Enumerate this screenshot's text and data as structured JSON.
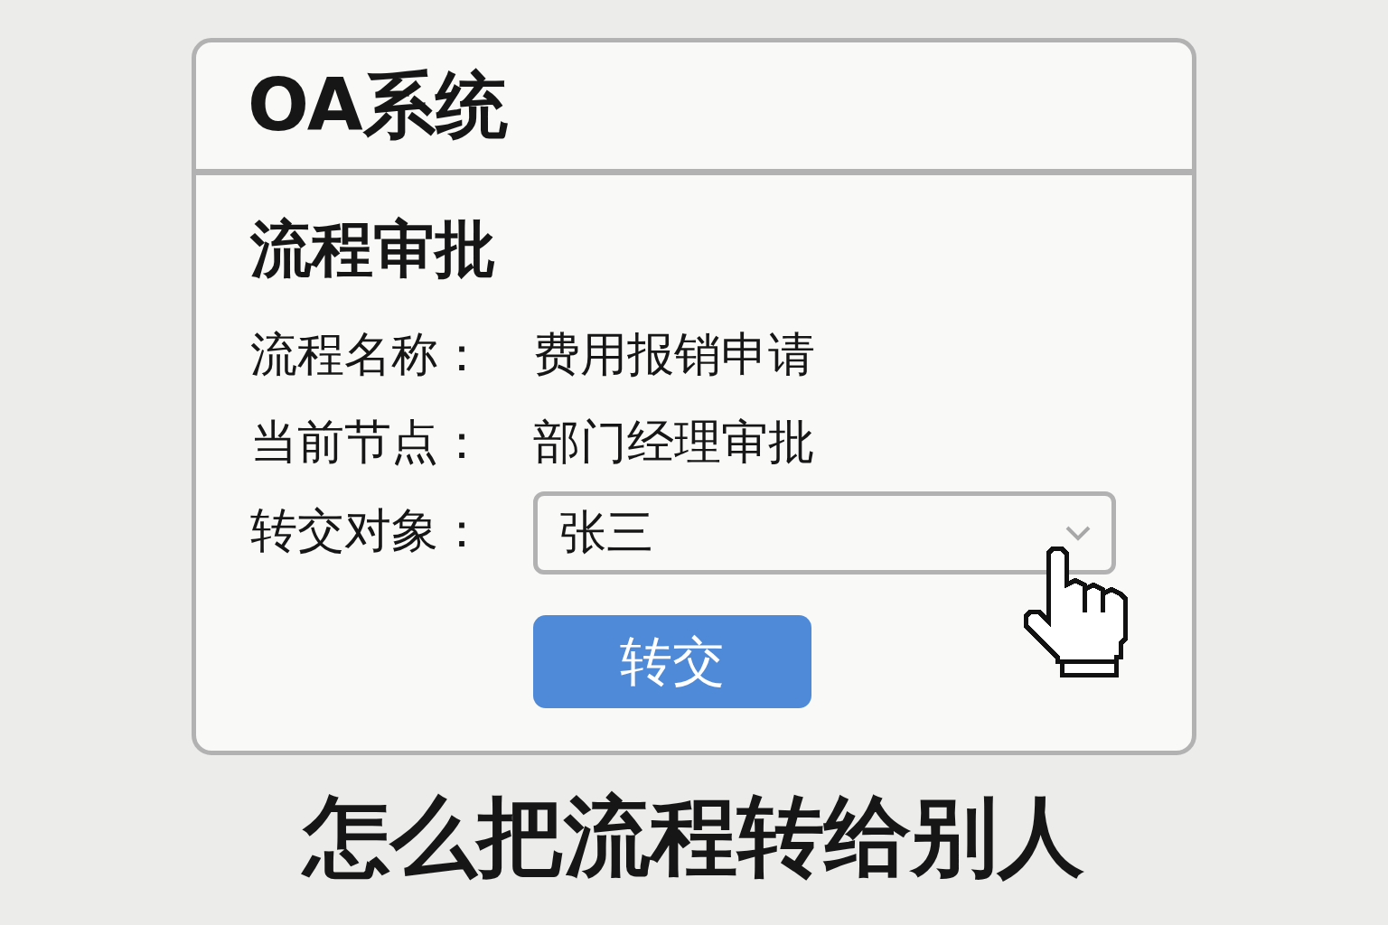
{
  "window": {
    "title": "OA系统"
  },
  "section": {
    "heading": "流程审批"
  },
  "fields": [
    {
      "kind": "text",
      "label": "流程名称：",
      "value": "费用报销申请"
    },
    {
      "kind": "text",
      "label": "当前节点：",
      "value": "部门经理审批"
    },
    {
      "kind": "select",
      "label": "转交对象：",
      "value": "张三"
    }
  ],
  "buttons": [
    "转交"
  ],
  "caption": "怎么把流程转给别人"
}
